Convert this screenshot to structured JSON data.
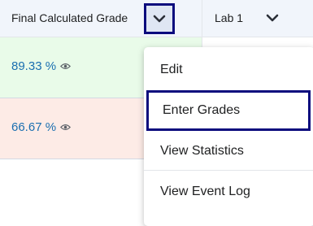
{
  "columns": [
    {
      "title": "Final Calculated Grade",
      "menu_icon": "chevron-down-icon"
    },
    {
      "title": "Lab 1",
      "menu_icon": "chevron-down-icon"
    }
  ],
  "rows": [
    {
      "grade": "89.33 %",
      "visibility_icon": "eye-icon",
      "status_color": "#e9fbe9"
    },
    {
      "grade": "66.67 %",
      "visibility_icon": "eye-icon",
      "status_color": "#fdebe6"
    }
  ],
  "menu": {
    "items": [
      {
        "label": "Edit"
      },
      {
        "label": "Enter Grades"
      },
      {
        "label": "View Statistics"
      },
      {
        "label": "View Event Log"
      }
    ]
  },
  "colors": {
    "focus_outline": "#0b0b7d",
    "link": "#1a6fb0",
    "header_bg": "#f1f5fb"
  }
}
